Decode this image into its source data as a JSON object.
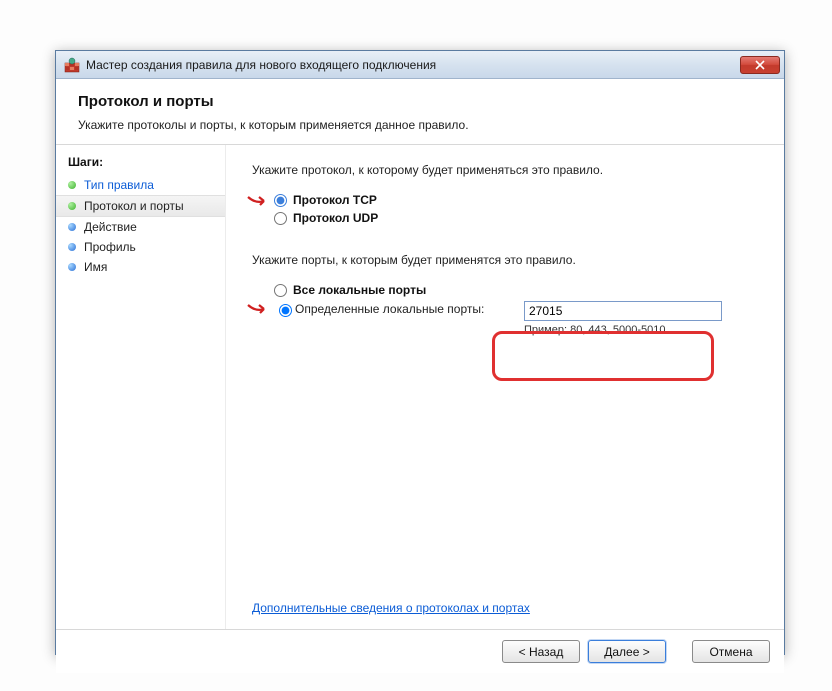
{
  "window": {
    "title": "Мастер создания правила для нового входящего подключения"
  },
  "header": {
    "title": "Протокол и порты",
    "subtitle": "Укажите протоколы и порты, к которым применяется данное правило."
  },
  "sidebar": {
    "label": "Шаги:",
    "steps": [
      {
        "label": "Тип правила"
      },
      {
        "label": "Протокол и порты"
      },
      {
        "label": "Действие"
      },
      {
        "label": "Профиль"
      },
      {
        "label": "Имя"
      }
    ]
  },
  "content": {
    "protocol_prompt": "Укажите протокол, к которому будет применяться это правило.",
    "tcp_label": "Протокол TCP",
    "udp_label": "Протокол UDP",
    "ports_prompt": "Укажите порты, к которым будет применятся это правило.",
    "all_ports_label": "Все локальные порты",
    "specific_ports_label": "Определенные локальные порты:",
    "port_value": "27015",
    "port_example": "Пример: 80, 443, 5000-5010",
    "learn_more": "Дополнительные сведения о протоколах и портах"
  },
  "footer": {
    "back": "< Назад",
    "next": "Далее >",
    "cancel": "Отмена"
  }
}
